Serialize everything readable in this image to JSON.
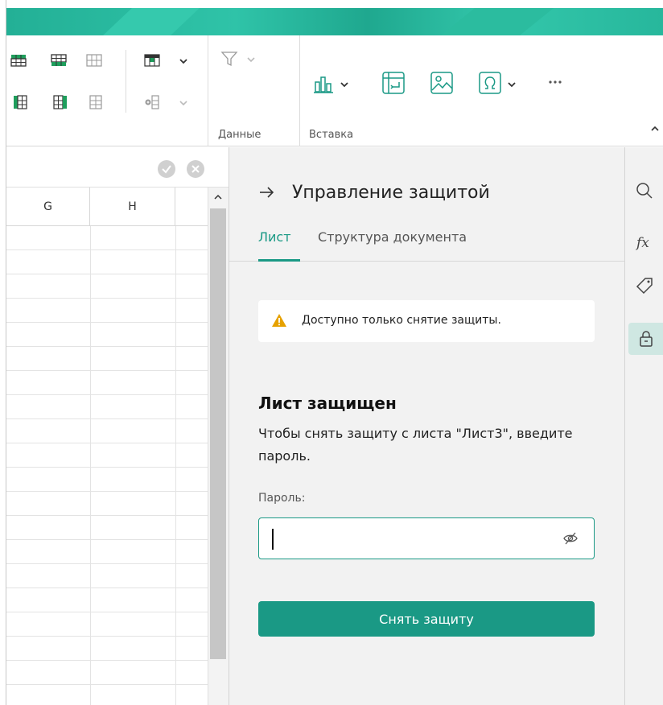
{
  "ribbon": {
    "groups": {
      "data": "Данные",
      "insert": "Вставка"
    },
    "collapse_chevron": "^"
  },
  "grid": {
    "columns": [
      "G",
      "H"
    ]
  },
  "panel": {
    "title": "Управление защитой",
    "tabs": [
      {
        "label": "Лист",
        "active": true
      },
      {
        "label": "Структура документа",
        "active": false
      }
    ],
    "warning": "Доступно только снятие защиты.",
    "heading": "Лист защищен",
    "description": "Чтобы снять защиту с листа \"Лист3\", введите пароль.",
    "password_label": "Пароль:",
    "password_value": "",
    "button_label": "Снять защиту"
  },
  "colors": {
    "accent": "#1a9985",
    "warning": "#e6a100"
  },
  "icons": {
    "side_rail": [
      "search-icon",
      "function-icon",
      "tag-icon",
      "lock-icon"
    ]
  }
}
